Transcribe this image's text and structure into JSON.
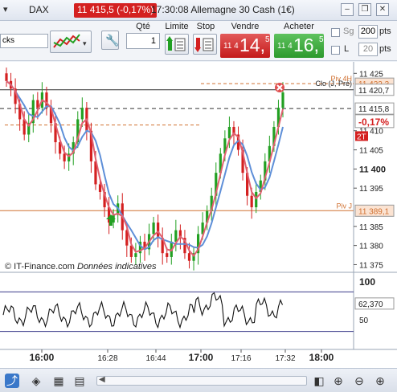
{
  "titlebar": {
    "menu_label": "▾",
    "instrument": "DAX",
    "price_badge": "11 415,5 (-0,17%)",
    "title": "17:30:08 Allemagne 30 Cash (1€)",
    "minimize": "–",
    "restore": "❒",
    "close": "✕"
  },
  "toolbar": {
    "combo_value": "cks",
    "qty_label": "Qté",
    "qty_value": "1",
    "limit_label": "Limite",
    "stop_label": "Stop",
    "sell_label": "Vendre",
    "buy_label": "Acheter",
    "sell_prefix": "11 4",
    "sell_big": "14,",
    "sell_sup": "5",
    "buy_prefix": "11 4",
    "buy_big": "16,",
    "buy_sup": "5",
    "sg_label": "Sg",
    "sg_value": "200",
    "sg_unit": "pts",
    "l_label": "L",
    "l_value": "20",
    "l_unit": "pts"
  },
  "chart": {
    "watermark": "© IT-Finance.com",
    "watermark_note": "Données indicatives",
    "price_axis": [
      "11 425",
      "11 420,7",
      "11 415,8",
      "11 410",
      "11 405",
      "11 400",
      "11 395",
      "11 389,1",
      "11 385",
      "11 380",
      "11 375"
    ],
    "label_tags": {
      "piv4h": "Piv 4H",
      "piv4h_value": "11 422,3",
      "clo": "Clo (J, Pré)",
      "clo_value": "11 420,7",
      "current_value": "11 415,8",
      "change": "-0,17%",
      "two_t": "2T",
      "pivj": "Piv J",
      "pivj_value": "11 389,1"
    },
    "time_axis": [
      "16:00",
      "16:28",
      "16:44",
      "17:00",
      "17:16",
      "17:32",
      "18:00"
    ],
    "osc_axis_top": "100",
    "osc_axis_mid": "50",
    "osc_value": "62,370"
  },
  "colors": {
    "bull": "#22a022",
    "bear": "#d42020",
    "ma_fast": "#e06070",
    "ma_slow": "#5e8fd8",
    "pivot": "#d07030"
  },
  "chart_data": {
    "type": "candlestick",
    "instrument": "DAX",
    "y_range": [
      11373,
      11428
    ],
    "x_ticks": [
      "16:00",
      "16:28",
      "16:44",
      "17:00",
      "17:16",
      "17:32",
      "18:00"
    ],
    "levels": {
      "piv4h": 11422.3,
      "clo": 11420.7,
      "last": 11415.8,
      "pivj": 11389.1
    },
    "closes": [
      11423,
      11421,
      11417,
      11413,
      11409,
      11412,
      11418,
      11416,
      11420,
      11416,
      11412,
      11407,
      11404,
      11402,
      11404,
      11407,
      11413,
      11416,
      11410,
      11402,
      11396,
      11394,
      11390,
      11386,
      11388,
      11391,
      11384,
      11380,
      11377,
      11378,
      11381,
      11379,
      11383,
      11386,
      11382,
      11378,
      11377,
      11381,
      11384,
      11382,
      11378,
      11376,
      11378,
      11383,
      11386,
      11389,
      11393,
      11399,
      11404,
      11408,
      11411,
      11409,
      11405,
      11399,
      11393,
      11390,
      11394,
      11397,
      11402,
      11406,
      11411,
      11416,
      11420
    ]
  },
  "osc_data": {
    "type": "line",
    "y_range": [
      0,
      100
    ],
    "level_top": 80,
    "level_bottom": 20,
    "last": 62.37
  }
}
